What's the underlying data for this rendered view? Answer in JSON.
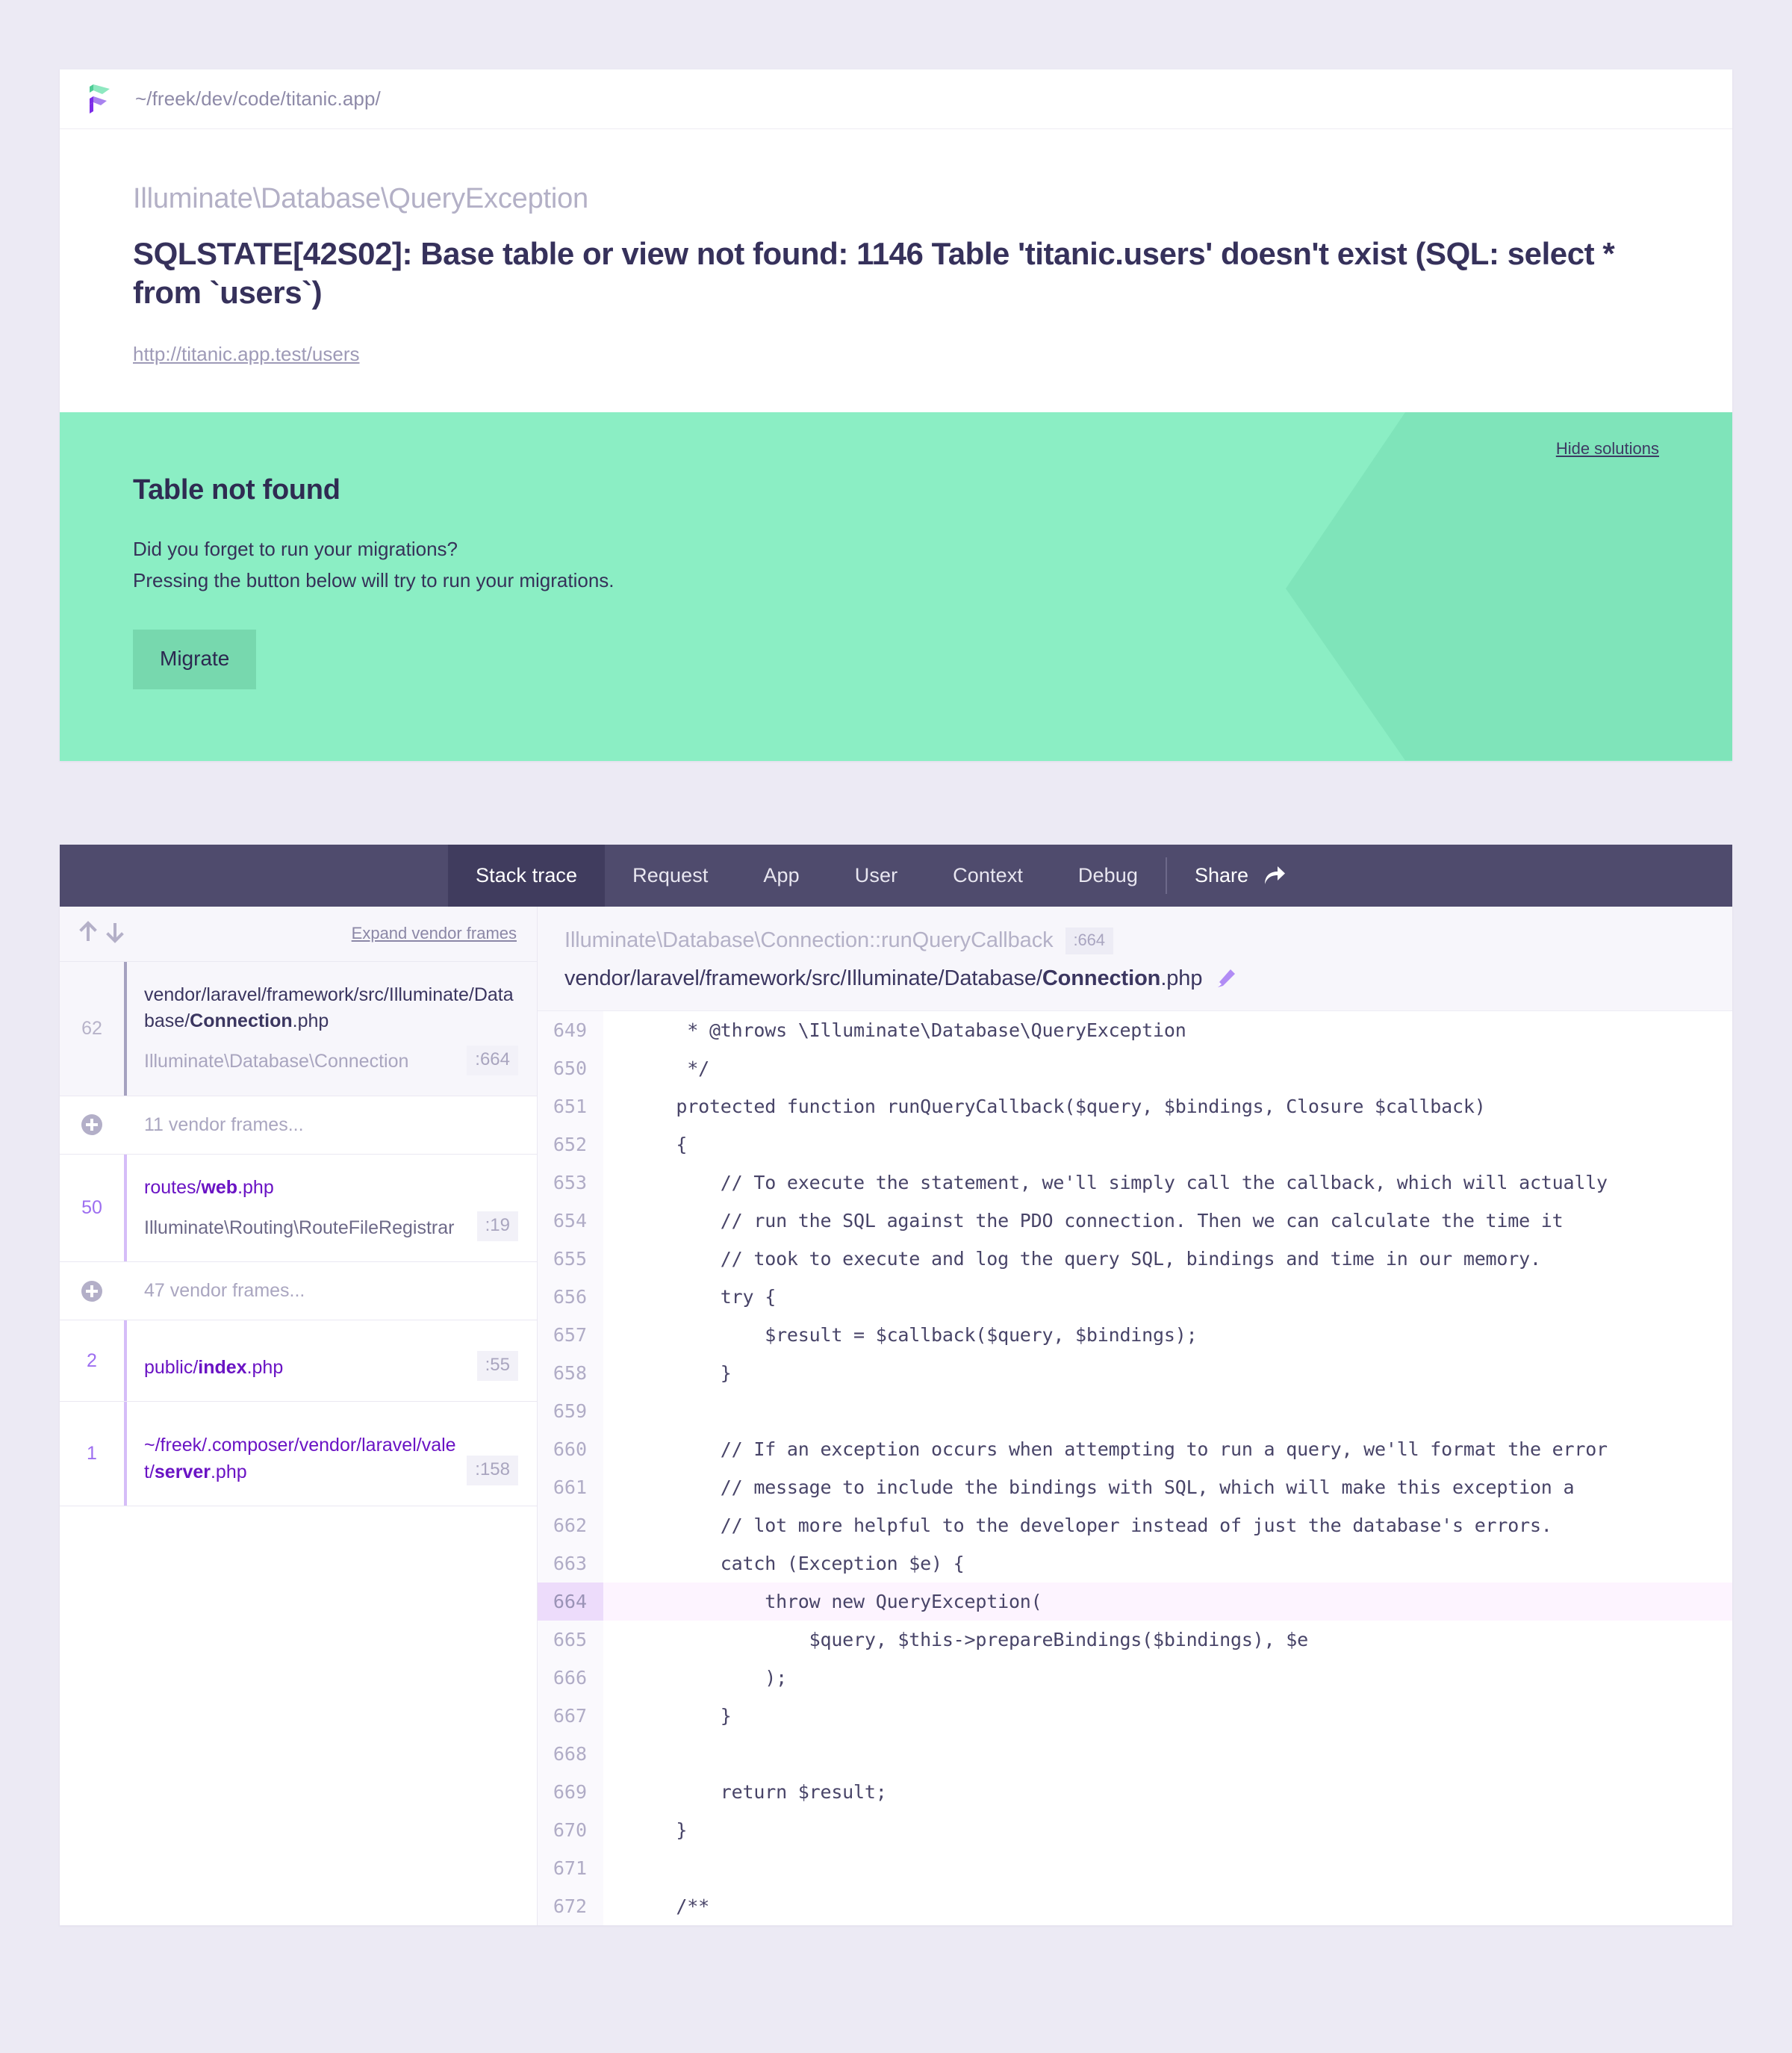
{
  "theme": {
    "page_bg": "#eceaf4",
    "accent_purple": "#6a13c4",
    "nav_bg": "#4f4b6d",
    "solution_bg": "#8beec4",
    "highlight_line_bg": "#fdf4ff"
  },
  "pathbar": {
    "icon": "ignition-flag-logo",
    "path": "~/freek/dev/code/titanic.app/"
  },
  "exception": {
    "class": "Illuminate\\Database\\QueryException",
    "message": "SQLSTATE[42S02]: Base table or view not found: 1146 Table 'titanic.users' doesn't exist (SQL: select * from `users`)",
    "url": "http://titanic.app.test/users"
  },
  "solution": {
    "hide_label": "Hide solutions",
    "title": "Table not found",
    "line1": "Did you forget to run your migrations?",
    "line2": "Pressing the button below will try to run your migrations.",
    "button_label": "Migrate"
  },
  "nav": {
    "tabs": [
      {
        "label": "Stack trace",
        "active": true
      },
      {
        "label": "Request",
        "active": false
      },
      {
        "label": "App",
        "active": false
      },
      {
        "label": "User",
        "active": false
      },
      {
        "label": "Context",
        "active": false
      },
      {
        "label": "Debug",
        "active": false
      }
    ],
    "share_label": "Share",
    "share_icon": "share-arrow-icon"
  },
  "frames_header": {
    "sort_up_icon": "arrow-up-icon",
    "sort_down_icon": "arrow-down-icon",
    "expand_label": "Expand vendor frames"
  },
  "frames": [
    {
      "kind": "frame",
      "number": "62",
      "selected": true,
      "app": false,
      "file_prefix": "vendor/laravel/framework/src/Illuminate/Database/",
      "file_name": "Connection",
      "file_ext": ".php",
      "class": "Illuminate\\Database\\Connection",
      "line": ":664"
    },
    {
      "kind": "vendor-group",
      "label": "11 vendor frames...",
      "icon": "plus-circle-icon"
    },
    {
      "kind": "frame",
      "number": "50",
      "selected": false,
      "app": true,
      "file_prefix": "routes/",
      "file_name": "web",
      "file_ext": ".php",
      "class": "Illuminate\\Routing\\RouteFileRegistrar",
      "line": ":19"
    },
    {
      "kind": "vendor-group",
      "label": "47 vendor frames...",
      "icon": "plus-circle-icon"
    },
    {
      "kind": "frame",
      "number": "2",
      "selected": false,
      "app": true,
      "file_prefix": "public/",
      "file_name": "index",
      "file_ext": ".php",
      "class": "",
      "line": ":55"
    },
    {
      "kind": "frame",
      "number": "1",
      "selected": false,
      "app": true,
      "file_prefix": "~/freek/.composer/vendor/laravel/valet/",
      "file_name": "server",
      "file_ext": ".php",
      "class": "",
      "line": ":158"
    }
  ],
  "code_header": {
    "class": "Illuminate\\Database\\Connection::runQueryCallback",
    "line": ":664",
    "path_prefix": "vendor/laravel/framework/src/Illuminate/Database/",
    "path_name": "Connection",
    "path_ext": ".php",
    "edit_icon": "pencil-icon"
  },
  "code": {
    "highlight_line": 664,
    "lines": [
      {
        "n": 649,
        "text": "     * @throws \\Illuminate\\Database\\QueryException"
      },
      {
        "n": 650,
        "text": "     */"
      },
      {
        "n": 651,
        "text": "    protected function runQueryCallback($query, $bindings, Closure $callback)"
      },
      {
        "n": 652,
        "text": "    {"
      },
      {
        "n": 653,
        "text": "        // To execute the statement, we'll simply call the callback, which will actually"
      },
      {
        "n": 654,
        "text": "        // run the SQL against the PDO connection. Then we can calculate the time it"
      },
      {
        "n": 655,
        "text": "        // took to execute and log the query SQL, bindings and time in our memory."
      },
      {
        "n": 656,
        "text": "        try {"
      },
      {
        "n": 657,
        "text": "            $result = $callback($query, $bindings);"
      },
      {
        "n": 658,
        "text": "        }"
      },
      {
        "n": 659,
        "text": ""
      },
      {
        "n": 660,
        "text": "        // If an exception occurs when attempting to run a query, we'll format the error"
      },
      {
        "n": 661,
        "text": "        // message to include the bindings with SQL, which will make this exception a"
      },
      {
        "n": 662,
        "text": "        // lot more helpful to the developer instead of just the database's errors."
      },
      {
        "n": 663,
        "text": "        catch (Exception $e) {"
      },
      {
        "n": 664,
        "text": "            throw new QueryException("
      },
      {
        "n": 665,
        "text": "                $query, $this->prepareBindings($bindings), $e"
      },
      {
        "n": 666,
        "text": "            );"
      },
      {
        "n": 667,
        "text": "        }"
      },
      {
        "n": 668,
        "text": ""
      },
      {
        "n": 669,
        "text": "        return $result;"
      },
      {
        "n": 670,
        "text": "    }"
      },
      {
        "n": 671,
        "text": ""
      },
      {
        "n": 672,
        "text": "    /**"
      }
    ]
  }
}
